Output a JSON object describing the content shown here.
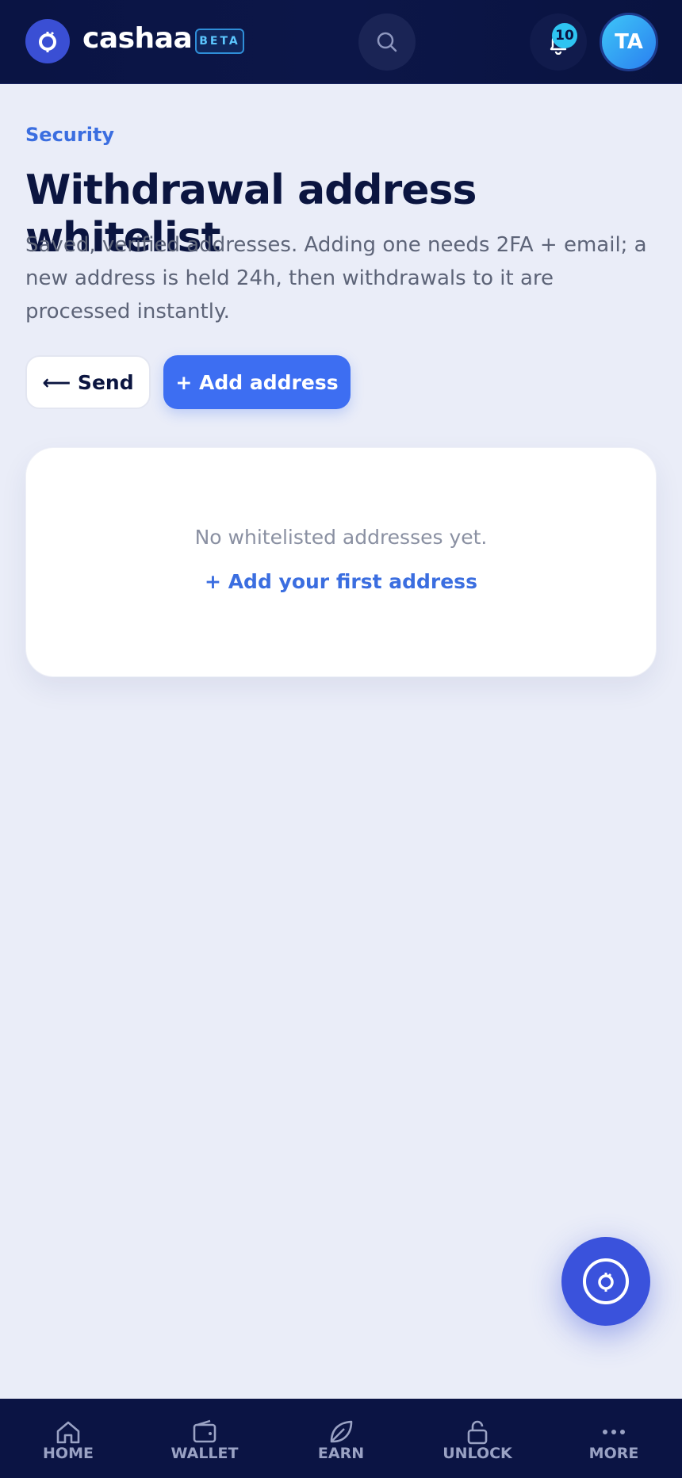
{
  "header": {
    "brand": "cashaa",
    "beta_label": "BETA",
    "notification_count": "10",
    "avatar_initials": "TA",
    "icons": [
      "logo-icon",
      "search-icon",
      "bell-icon"
    ]
  },
  "page": {
    "eyebrow": "Security",
    "title": "Withdrawal address whitelist",
    "subtitle": "Saved, verified addresses. Adding one needs 2FA + email; a new address is held 24h, then withdrawals to it are processed instantly."
  },
  "actions": {
    "send_label": "⟵ Send",
    "add_label": "+ Add address"
  },
  "empty_state": {
    "message": "No whitelisted addresses yet.",
    "link_label": "+ Add your first address"
  },
  "bottom_nav": {
    "items": [
      {
        "label": "HOME",
        "icon": "home-icon"
      },
      {
        "label": "WALLET",
        "icon": "wallet-icon"
      },
      {
        "label": "EARN",
        "icon": "leaf-icon"
      },
      {
        "label": "UNLOCK",
        "icon": "unlock-icon"
      },
      {
        "label": "MORE",
        "icon": "more-icon"
      }
    ]
  },
  "colors": {
    "header_bg": "#0a1444",
    "accent": "#3d6ef2",
    "badge": "#2ec4f2",
    "page_bg": "#eaedf8"
  }
}
